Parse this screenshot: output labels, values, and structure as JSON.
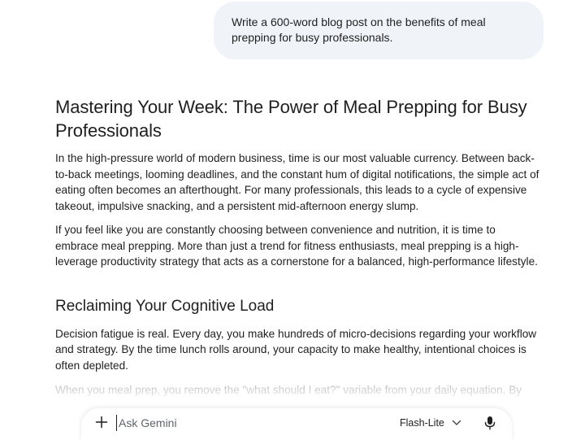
{
  "user_prompt": "Write a 600-word blog post on the benefits of meal prepping for busy professionals.",
  "response": {
    "title": "Mastering Your Week: The Power of Meal Prepping for Busy Professionals",
    "paragraphs": [
      "In the high-pressure world of modern business, time is our most valuable currency. Between back-to-back meetings, looming deadlines, and the constant hum of digital notifications, the simple act of eating often becomes an afterthought. For many professionals, this leads to a cycle of expensive takeout, impulsive snacking, and a persistent mid-afternoon energy slump.",
      "If you feel like you are constantly choosing between convenience and nutrition, it is time to embrace meal prepping. More than just a trend for fitness enthusiasts, meal prepping is a high-leverage productivity strategy that acts as a cornerstone for a balanced, high-performance lifestyle."
    ],
    "section_heading": "Reclaiming Your Cognitive Load",
    "section_paragraphs": [
      "Decision fatigue is real. Every day, you make hundreds of micro-decisions regarding your workflow and strategy. By the time lunch rolls around, your capacity to make healthy, intentional choices is often depleted.",
      "When you meal prep, you remove the \"what should I eat?\" variable from your daily equation. By"
    ]
  },
  "composer": {
    "placeholder": "Ask Gemini",
    "model_label": "Flash-Lite",
    "icons": {
      "add": "plus-icon",
      "model_dropdown": "chevron-down-icon",
      "voice": "microphone-icon"
    }
  },
  "colors": {
    "user_bubble": "#f0f4f9",
    "text": "#1f1f1f",
    "background": "#ffffff"
  }
}
